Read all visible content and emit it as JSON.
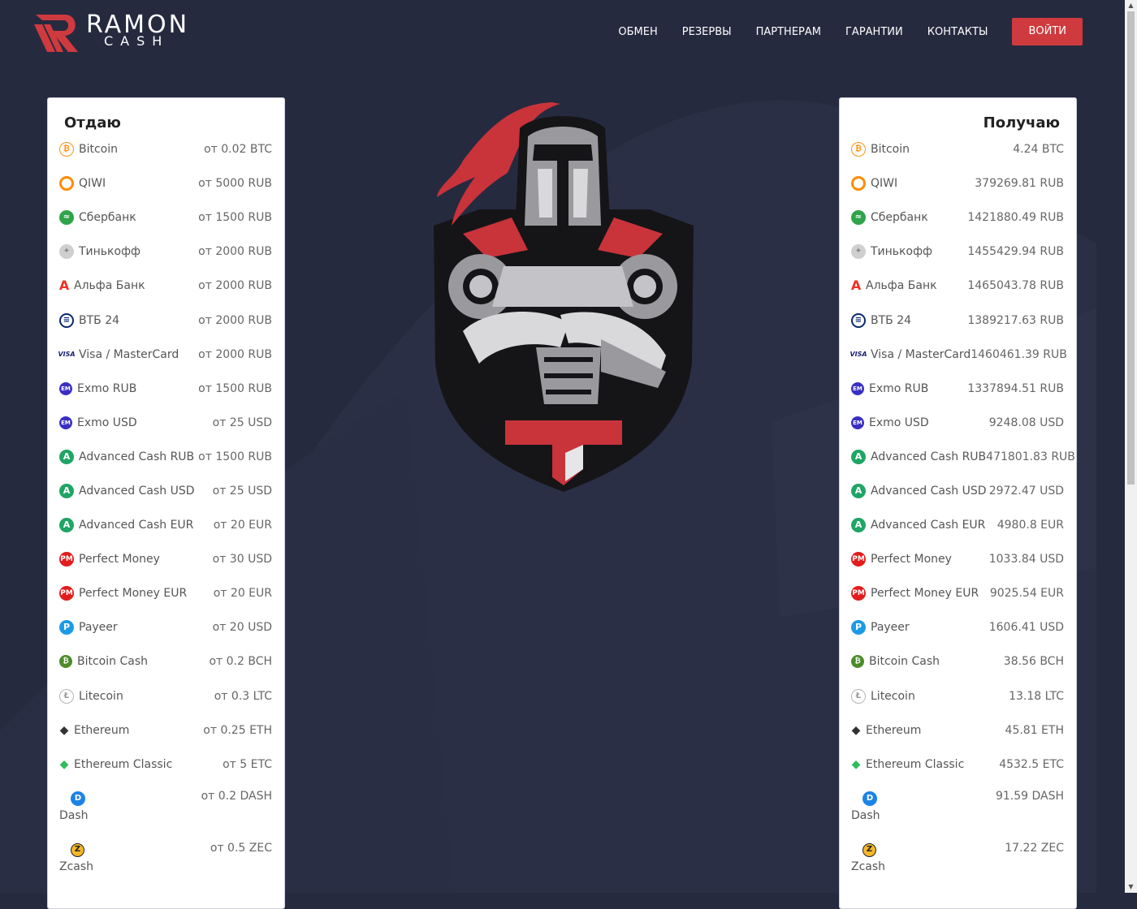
{
  "logo": {
    "main": "RAMON",
    "sub": "CASH"
  },
  "nav": {
    "items": [
      "ОБМЕН",
      "РЕЗЕРВЫ",
      "ПАРТНЕРАМ",
      "ГАРАНТИИ",
      "КОНТАКТЫ"
    ],
    "login": "ВОЙТИ"
  },
  "colors": {
    "accent": "#cf3a3f",
    "background": "#262a3f",
    "panel": "#ffffff"
  },
  "give": {
    "title": "Отдаю",
    "rows": [
      {
        "name": "Bitcoin",
        "value": "от 0.02 BTC",
        "icon": "btc"
      },
      {
        "name": "QIWI",
        "value": "от 5000 RUB",
        "icon": "qiwi"
      },
      {
        "name": "Сбербанк",
        "value": "от 1500 RUB",
        "icon": "sber"
      },
      {
        "name": "Тинькофф",
        "value": "от 2000 RUB",
        "icon": "tink"
      },
      {
        "name": "Альфа Банк",
        "value": "от 2000 RUB",
        "icon": "alfa"
      },
      {
        "name": "ВТБ 24",
        "value": "от 2000 RUB",
        "icon": "vtb"
      },
      {
        "name": "Visa / MasterCard",
        "value": "от 2000 RUB",
        "icon": "visa"
      },
      {
        "name": "Exmo RUB",
        "value": "от 1500 RUB",
        "icon": "exmo"
      },
      {
        "name": "Exmo USD",
        "value": "от 25 USD",
        "icon": "exmo"
      },
      {
        "name": "Advanced Cash RUB",
        "value": "от 1500 RUB",
        "icon": "adv"
      },
      {
        "name": "Advanced Cash USD",
        "value": "от 25 USD",
        "icon": "adv"
      },
      {
        "name": "Advanced Cash EUR",
        "value": "от 20 EUR",
        "icon": "adv"
      },
      {
        "name": "Perfect Money",
        "value": "от 30 USD",
        "icon": "pm"
      },
      {
        "name": "Perfect Money EUR",
        "value": "от 20 EUR",
        "icon": "pm"
      },
      {
        "name": "Payeer",
        "value": "от 20 USD",
        "icon": "payeer"
      },
      {
        "name": "Bitcoin Cash",
        "value": "от 0.2 BCH",
        "icon": "bch"
      },
      {
        "name": "Litecoin",
        "value": "от 0.3 LTC",
        "icon": "ltc"
      },
      {
        "name": "Ethereum",
        "value": "от 0.25 ETH",
        "icon": "eth"
      },
      {
        "name": "Ethereum Classic",
        "value": "от 5 ETC",
        "icon": "etc"
      },
      {
        "name": "Dash",
        "value": "от 0.2 DASH",
        "icon": "dash",
        "tall": true
      },
      {
        "name": "Zcash",
        "value": "от 0.5 ZEC",
        "icon": "zec",
        "tall": true
      }
    ]
  },
  "get": {
    "title": "Получаю",
    "rows": [
      {
        "name": "Bitcoin",
        "value": "4.24 BTC",
        "icon": "btc"
      },
      {
        "name": "QIWI",
        "value": "379269.81 RUB",
        "icon": "qiwi"
      },
      {
        "name": "Сбербанк",
        "value": "1421880.49 RUB",
        "icon": "sber"
      },
      {
        "name": "Тинькофф",
        "value": "1455429.94 RUB",
        "icon": "tink"
      },
      {
        "name": "Альфа Банк",
        "value": "1465043.78 RUB",
        "icon": "alfa"
      },
      {
        "name": "ВТБ 24",
        "value": "1389217.63 RUB",
        "icon": "vtb"
      },
      {
        "name": "Visa / MasterCard",
        "value": "1460461.39 RUB",
        "icon": "visa"
      },
      {
        "name": "Exmo RUB",
        "value": "1337894.51 RUB",
        "icon": "exmo"
      },
      {
        "name": "Exmo USD",
        "value": "9248.08 USD",
        "icon": "exmo"
      },
      {
        "name": "Advanced Cash RUB",
        "value": "471801.83 RUB",
        "icon": "adv"
      },
      {
        "name": "Advanced Cash USD",
        "value": "2972.47 USD",
        "icon": "adv"
      },
      {
        "name": "Advanced Cash EUR",
        "value": "4980.8 EUR",
        "icon": "adv"
      },
      {
        "name": "Perfect Money",
        "value": "1033.84 USD",
        "icon": "pm"
      },
      {
        "name": "Perfect Money EUR",
        "value": "9025.54 EUR",
        "icon": "pm"
      },
      {
        "name": "Payeer",
        "value": "1606.41 USD",
        "icon": "payeer"
      },
      {
        "name": "Bitcoin Cash",
        "value": "38.56 BCH",
        "icon": "bch"
      },
      {
        "name": "Litecoin",
        "value": "13.18 LTC",
        "icon": "ltc"
      },
      {
        "name": "Ethereum",
        "value": "45.81 ETH",
        "icon": "eth"
      },
      {
        "name": "Ethereum Classic",
        "value": "4532.5 ETC",
        "icon": "etc"
      },
      {
        "name": "Dash",
        "value": "91.59 DASH",
        "icon": "dash",
        "tall": true
      },
      {
        "name": "Zcash",
        "value": "17.22 ZEC",
        "icon": "zec",
        "tall": true
      }
    ]
  }
}
